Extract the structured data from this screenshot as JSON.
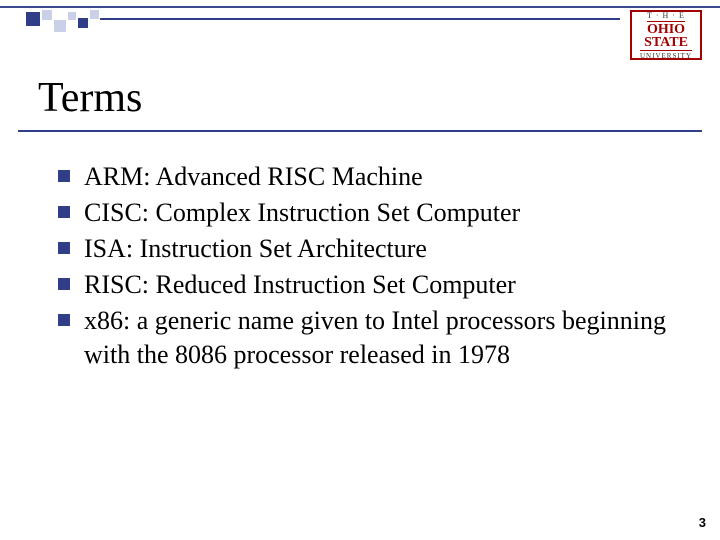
{
  "logo": {
    "top": "T · H · E",
    "main_line1": "OHIO",
    "main_line2": "STATE",
    "bottom": "UNIVERSITY"
  },
  "title": "Terms",
  "bullets": [
    "ARM: Advanced RISC Machine",
    "CISC: Complex Instruction Set Computer",
    "ISA: Instruction Set Architecture",
    "RISC: Reduced Instruction Set Computer",
    "x86: a generic name given to Intel processors beginning with the 8086 processor released in 1978"
  ],
  "page_number": "3"
}
